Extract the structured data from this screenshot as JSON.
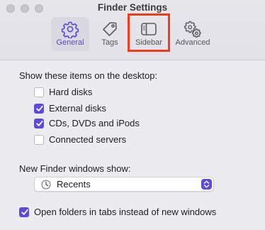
{
  "window": {
    "title": "Finder Settings"
  },
  "toolbar": {
    "tabs": [
      {
        "label": "General",
        "icon": "gear-icon",
        "selected": true
      },
      {
        "label": "Tags",
        "icon": "tag-icon",
        "selected": false
      },
      {
        "label": "Sidebar",
        "icon": "sidebar-icon",
        "selected": false
      },
      {
        "label": "Advanced",
        "icon": "gears-icon",
        "selected": false
      }
    ],
    "highlight_color": "#f23a1c"
  },
  "desktop": {
    "heading": "Show these items on the desktop:",
    "items": [
      {
        "label": "Hard disks",
        "checked": false
      },
      {
        "label": "External disks",
        "checked": true
      },
      {
        "label": "CDs, DVDs and iPods",
        "checked": true
      },
      {
        "label": "Connected servers",
        "checked": false
      }
    ]
  },
  "new_windows": {
    "heading": "New Finder windows show:",
    "selected": "Recents",
    "icon": "clock-icon"
  },
  "tabs_option": {
    "label": "Open folders in tabs instead of new windows",
    "checked": true
  },
  "colors": {
    "accent": "#5d4ad8",
    "selected_tab_label": "#5a48d6"
  }
}
